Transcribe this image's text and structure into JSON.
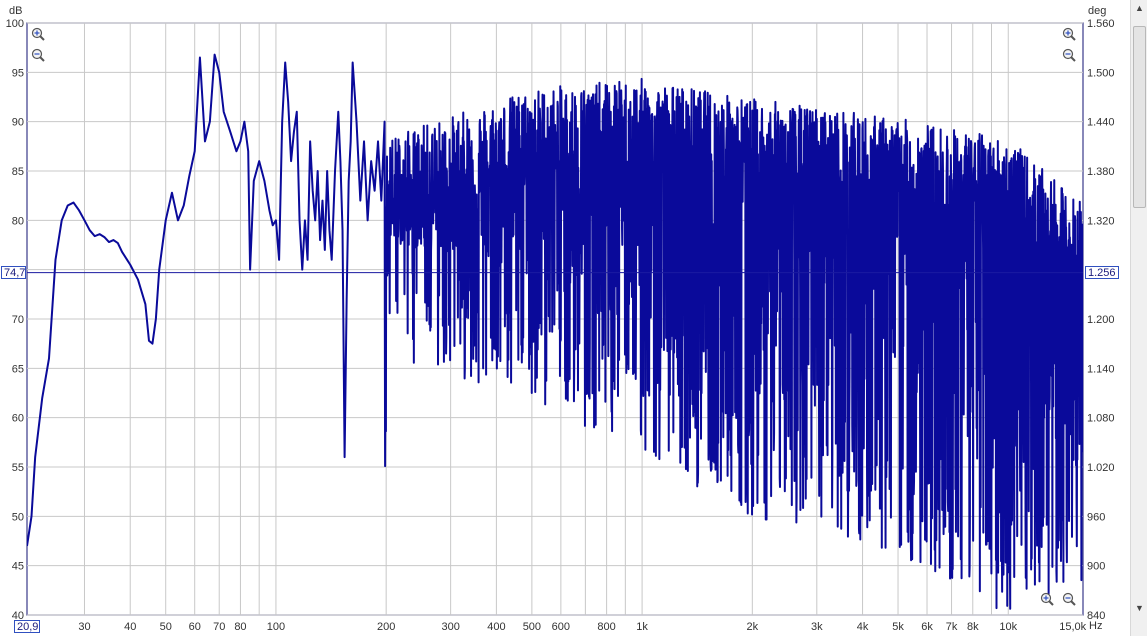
{
  "chart_data": {
    "type": "line",
    "title": "",
    "xlabel": "Hz",
    "ylabel": "dB",
    "y2label": "deg",
    "xscale": "log",
    "xlim": [
      20.9,
      16000
    ],
    "ylim": [
      40,
      100
    ],
    "y2lim": [
      840,
      1560
    ],
    "grid": true,
    "legend": "none",
    "x_tick_labels": [
      "30",
      "40",
      "50",
      "60",
      "70",
      "80",
      "100",
      "200",
      "300",
      "400",
      "500",
      "600",
      "800",
      "1k",
      "2k",
      "3k",
      "4k",
      "5k",
      "6k",
      "7k",
      "8k",
      "10k",
      "15,0k"
    ],
    "x_tick_values": [
      30,
      40,
      50,
      60,
      70,
      80,
      100,
      200,
      300,
      400,
      500,
      600,
      800,
      1000,
      2000,
      3000,
      4000,
      5000,
      6000,
      7000,
      8000,
      10000,
      15000
    ],
    "y_tick_labels": [
      "100",
      "95",
      "90",
      "85",
      "80",
      "75",
      "70",
      "65",
      "60",
      "55",
      "50",
      "45",
      "40"
    ],
    "y_tick_values": [
      100,
      95,
      90,
      85,
      80,
      75,
      70,
      65,
      60,
      55,
      50,
      45,
      40
    ],
    "y2_tick_labels": [
      "1.560",
      "1.500",
      "1.440",
      "1.380",
      "1.320",
      "1.256",
      "1.200",
      "1.140",
      "1.080",
      "1.020",
      "960",
      "900",
      "840"
    ],
    "cursor": {
      "level_db": 74.7,
      "level_label": "74,7",
      "x_label": "20,9",
      "phase_label": "1.256"
    },
    "series": [
      {
        "color": "#0a0a9a",
        "smooth_points": [
          [
            20.9,
            47
          ],
          [
            21.5,
            50
          ],
          [
            22,
            56
          ],
          [
            23,
            62
          ],
          [
            24,
            66
          ],
          [
            25,
            76
          ],
          [
            26,
            80
          ],
          [
            27,
            81.5
          ],
          [
            28,
            81.8
          ],
          [
            29,
            81
          ],
          [
            30,
            80
          ],
          [
            31,
            79
          ],
          [
            32,
            78.4
          ],
          [
            33,
            78.6
          ],
          [
            34,
            78.3
          ],
          [
            35,
            77.8
          ],
          [
            36,
            78
          ],
          [
            37,
            77.7
          ],
          [
            38,
            76.8
          ],
          [
            40,
            75.5
          ],
          [
            42,
            74
          ],
          [
            44,
            71.5
          ],
          [
            45,
            67.8
          ],
          [
            46,
            67.5
          ],
          [
            47,
            70
          ],
          [
            48,
            75
          ],
          [
            50,
            80
          ],
          [
            52,
            82.8
          ],
          [
            54,
            80
          ],
          [
            56,
            81.5
          ],
          [
            58,
            84.5
          ],
          [
            60,
            87
          ],
          [
            62,
            96.5
          ],
          [
            64,
            88
          ],
          [
            66,
            90
          ],
          [
            68,
            96.8
          ],
          [
            70,
            95
          ],
          [
            72,
            91
          ],
          [
            75,
            89
          ],
          [
            78,
            87
          ],
          [
            80,
            88
          ],
          [
            82,
            90
          ],
          [
            84,
            87
          ],
          [
            85,
            75
          ],
          [
            87,
            84
          ],
          [
            90,
            86
          ],
          [
            93,
            84
          ],
          [
            96,
            81
          ],
          [
            98,
            79.5
          ],
          [
            100,
            80
          ],
          [
            102,
            76
          ],
          [
            104,
            90
          ],
          [
            106,
            96
          ],
          [
            108,
            92
          ],
          [
            110,
            86
          ],
          [
            112,
            89
          ],
          [
            114,
            91
          ],
          [
            116,
            80
          ],
          [
            118,
            75
          ],
          [
            120,
            80
          ],
          [
            122,
            76
          ],
          [
            124,
            88
          ],
          [
            126,
            83
          ],
          [
            128,
            80
          ],
          [
            130,
            85
          ],
          [
            132,
            78
          ],
          [
            134,
            82
          ],
          [
            136,
            77
          ],
          [
            138,
            85
          ],
          [
            140,
            79
          ],
          [
            142,
            76
          ],
          [
            145,
            85
          ],
          [
            148,
            91
          ],
          [
            150,
            86
          ],
          [
            152,
            79
          ],
          [
            154,
            56
          ],
          [
            156,
            72
          ],
          [
            158,
            84
          ],
          [
            160,
            88
          ],
          [
            162,
            96
          ],
          [
            164,
            93
          ],
          [
            166,
            90
          ],
          [
            170,
            82
          ],
          [
            174,
            88
          ],
          [
            178,
            80
          ],
          [
            182,
            86
          ],
          [
            186,
            83
          ],
          [
            190,
            88
          ],
          [
            194,
            82
          ],
          [
            198,
            90
          ]
        ],
        "hf_noise": {
          "f_start": 198,
          "f_end": 16000,
          "max_envelope_db": [
            [
              200,
              89
            ],
            [
              500,
              94
            ],
            [
              1000,
              95
            ],
            [
              2000,
              93
            ],
            [
              5000,
              91
            ],
            [
              10000,
              89
            ],
            [
              15000,
              83
            ]
          ],
          "min_envelope_db": [
            [
              200,
              66
            ],
            [
              500,
              62
            ],
            [
              1000,
              56
            ],
            [
              2000,
              50
            ],
            [
              5000,
              46
            ],
            [
              10000,
              40
            ],
            [
              15000,
              43
            ]
          ]
        }
      }
    ]
  }
}
